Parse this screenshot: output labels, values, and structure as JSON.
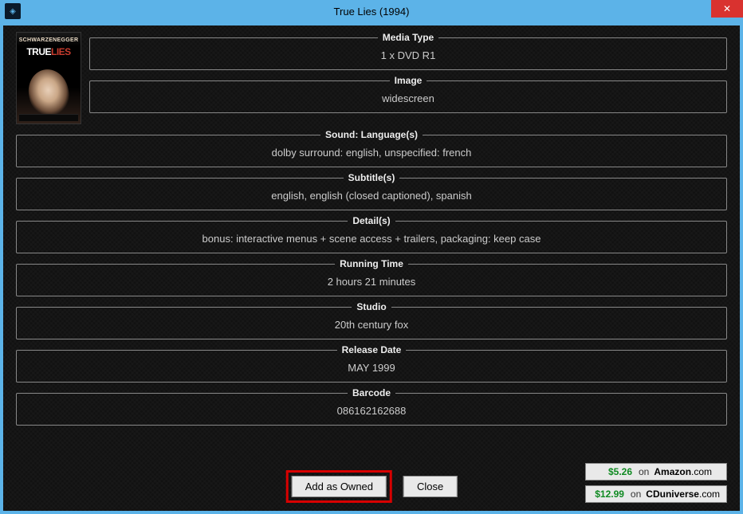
{
  "window": {
    "title": "True Lies (1994)",
    "close_symbol": "✕"
  },
  "poster": {
    "top_banner": "SCHWARZENEGGER",
    "title_white": "TRUE",
    "title_red": "LIES"
  },
  "fields": {
    "media_type": {
      "label": "Media Type",
      "value": "1 x DVD R1"
    },
    "image": {
      "label": "Image",
      "value": "widescreen"
    },
    "sound": {
      "label": "Sound: Language(s)",
      "value": "dolby surround: english, unspecified: french"
    },
    "subtitles": {
      "label": "Subtitle(s)",
      "value": "english, english (closed captioned), spanish"
    },
    "details": {
      "label": "Detail(s)",
      "value": "bonus: interactive menus + scene access + trailers, packaging: keep case"
    },
    "running_time": {
      "label": "Running Time",
      "value": "2 hours 21 minutes"
    },
    "studio": {
      "label": "Studio",
      "value": "20th century fox"
    },
    "release_date": {
      "label": "Release Date",
      "value": "MAY 1999"
    },
    "barcode": {
      "label": "Barcode",
      "value": "086162162688"
    }
  },
  "buttons": {
    "add_owned": "Add as Owned",
    "close": "Close"
  },
  "prices": [
    {
      "price": "$5.26",
      "on": "on",
      "store_bold": "Amazon",
      "store_rest": ".com"
    },
    {
      "price": "$12.99",
      "on": "on",
      "store_bold": "CDuniverse",
      "store_rest": ".com"
    }
  ]
}
